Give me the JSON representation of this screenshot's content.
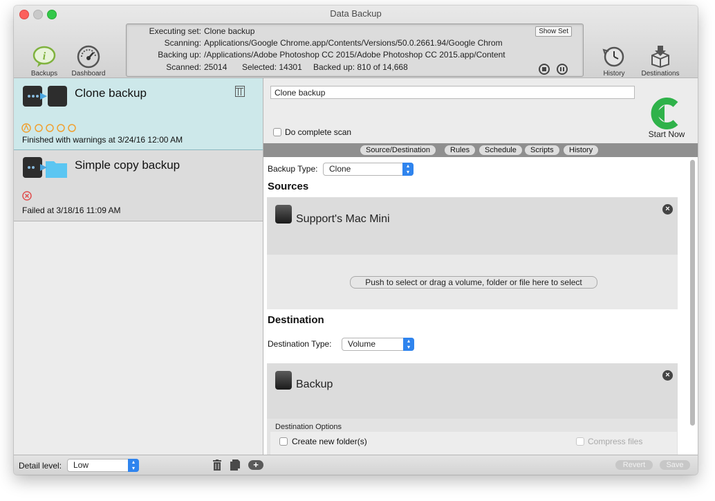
{
  "window": {
    "title": "Data Backup"
  },
  "toolbar": {
    "backups_label": "Backups",
    "dashboard_label": "Dashboard",
    "history_label": "History",
    "destinations_label": "Destinations"
  },
  "status": {
    "executing_label": "Executing set:",
    "executing_value": "Clone backup",
    "scanning_label": "Scanning:",
    "scanning_value": "Applications/Google Chrome.app/Contents/Versions/50.0.2661.94/Google Chrom",
    "backing_label": "Backing up:",
    "backing_value": "/Applications/Adobe Photoshop CC 2015/Adobe Photoshop CC 2015.app/Content",
    "scanned_label": "Scanned:",
    "scanned_value": "25014",
    "selected_text": "Selected: 14301",
    "backedup_text": "Backed up: 810 of 14,668",
    "show_set_label": "Show Set"
  },
  "sets": [
    {
      "name": "Clone backup",
      "status": "Finished with warnings at 3/24/16 12:00 AM"
    },
    {
      "name": "Simple copy backup",
      "status": "Failed at 3/18/16 11:09 AM"
    }
  ],
  "editor": {
    "name_value": "Clone backup",
    "complete_scan_label": "Do complete scan",
    "start_now_label": "Start Now",
    "tabs": [
      "Source/Destination",
      "Rules",
      "Schedule",
      "Scripts",
      "History"
    ],
    "backup_type_label": "Backup Type:",
    "backup_type_value": "Clone",
    "sources_heading": "Sources",
    "source_name": "Support's Mac Mini",
    "push_select_label": "Push to select or drag a volume, folder or file here to select",
    "destination_heading": "Destination",
    "destination_type_label": "Destination Type:",
    "destination_type_value": "Volume",
    "destination_name": "Backup",
    "destination_options_label": "Destination Options",
    "create_folder_label": "Create new folder(s)",
    "compress_files_label": "Compress files"
  },
  "bottom": {
    "detail_level_label": "Detail level:",
    "detail_level_value": "Low",
    "add_label": "+",
    "revert_label": "Revert",
    "save_label": "Save"
  },
  "colors": {
    "selected_row": "#cde8ea",
    "warning": "#f0a030",
    "error": "#e05050",
    "accent_blue": "#2f84ee",
    "start_green": "#2fb24a"
  }
}
